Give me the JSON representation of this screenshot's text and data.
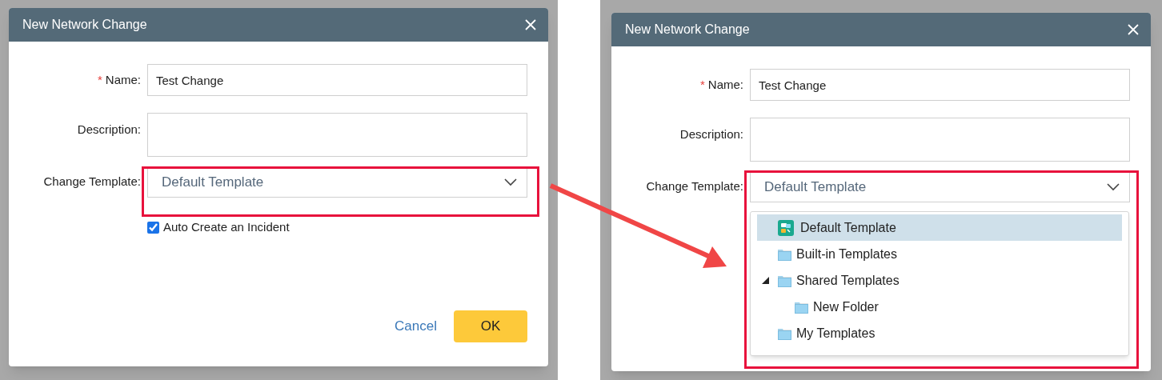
{
  "screens": [
    {
      "title": "New Network Change",
      "required_mark": "*",
      "name_label": "Name:",
      "name_value": "Test Change",
      "description_label": "Description:",
      "template_label": "Change Template:",
      "template_value": "Default Template",
      "highlighted": true,
      "checkbox": {
        "label": "Auto Create an Incident",
        "checked": true
      },
      "buttons": [
        {
          "label": "Cancel",
          "kind": "link"
        },
        {
          "label": "OK",
          "kind": "primary"
        }
      ]
    },
    {
      "title": "New Network Change",
      "required_mark": "*",
      "name_label": "Name:",
      "name_value": "Test Change",
      "description_label": "Description:",
      "template_label": "Change Template:",
      "template_value": "Default Template",
      "highlighted": true,
      "dropdown": {
        "items": [
          {
            "label": "Default Template",
            "kind": "template",
            "selected": true
          },
          {
            "label": "Built-in Templates",
            "kind": "folder",
            "selected": false
          },
          {
            "label": "Shared Templates",
            "kind": "folder",
            "selected": false,
            "expanded": true,
            "children": [
              {
                "label": "New Folder",
                "kind": "folder",
                "selected": false
              }
            ]
          },
          {
            "label": "My Templates",
            "kind": "folder",
            "selected": false
          }
        ]
      }
    }
  ]
}
